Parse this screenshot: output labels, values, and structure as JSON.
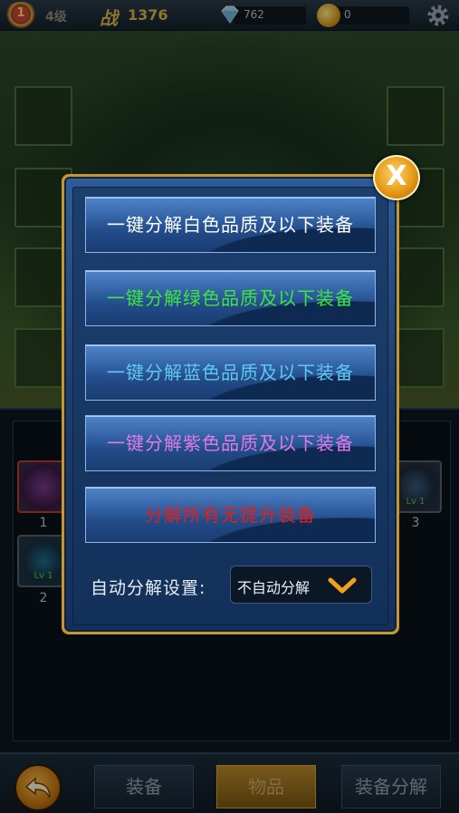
{
  "header": {
    "level_badge": "1",
    "level": "4级",
    "power_label": "战",
    "power_value": "1376",
    "gems": "762",
    "coins": "0",
    "icons": {
      "gem": "diamond-icon",
      "coin": "coin-icon",
      "settings": "gear-icon"
    }
  },
  "inventory": {
    "items": [
      {
        "number": "1",
        "level": ""
      },
      {
        "number": "2",
        "level": "Lv 1"
      },
      {
        "number": "3",
        "level": "Lv 1"
      }
    ]
  },
  "dialog": {
    "buttons": [
      {
        "label": "一键分解白色品质及以下装备",
        "color": "#ffffff"
      },
      {
        "label": "一键分解绿色品质及以下装备",
        "color": "#3ee53e"
      },
      {
        "label": "一键分解蓝色品质及以下装备",
        "color": "#5fc9f0"
      },
      {
        "label": "一键分解紫色品质及以下装备",
        "color": "#e07ae6"
      },
      {
        "label": "分解所有无提升装备",
        "color": "#e0201a"
      }
    ],
    "auto_label": "自动分解设置:",
    "auto_value": "不自动分解",
    "close_symbol": "X"
  },
  "bottom_tabs": [
    {
      "label": "装备",
      "active": false
    },
    {
      "label": "物品",
      "active": true
    },
    {
      "label": "装备分解",
      "active": false
    }
  ]
}
